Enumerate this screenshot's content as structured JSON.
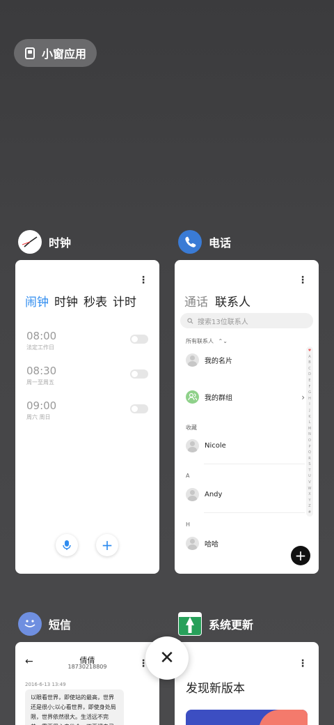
{
  "small_window": {
    "label": "小窗应用"
  },
  "apps": {
    "clock": {
      "name": "时钟",
      "tabs": [
        "闹钟",
        "时钟",
        "秒表",
        "计时"
      ],
      "alarms": [
        {
          "time": "08:00",
          "repeat": "法定工作日"
        },
        {
          "time": "08:30",
          "repeat": "周一至周五"
        },
        {
          "time": "09:00",
          "repeat": "周六 周日"
        }
      ]
    },
    "phone": {
      "name": "电话",
      "tabs": [
        "通话",
        "联系人"
      ],
      "search_placeholder": "搜索13位联系人",
      "filter_label": "所有联系人",
      "sections": {
        "favorites": "收藏",
        "a": "A",
        "h": "H"
      },
      "rows": {
        "my_card": "我的名片",
        "my_group": "我的群组",
        "nicole": "Nicole",
        "andy": "Andy",
        "haha": "哈哈"
      },
      "alpha_index": [
        "♥",
        "A",
        "B",
        "C",
        "D",
        "E",
        "F",
        "G",
        "H",
        "I",
        "J",
        "K",
        "L",
        "M",
        "N",
        "O",
        "P",
        "Q",
        "R",
        "S",
        "T",
        "U",
        "V",
        "W",
        "X",
        "Y",
        "Z",
        "#"
      ]
    },
    "sms": {
      "name": "短信",
      "contact": "倩倩",
      "number": "18730218809",
      "date": "2016-6-13 13:49",
      "message": "以眼看世界，即使站的最高，世界还是很小;以心看世界，即使身处局限，世界依然很大。生活远不完美，需要用心去体会，不要把自己"
    },
    "update": {
      "name": "系统更新",
      "title": "发现新版本"
    }
  },
  "colors": {
    "accent": "#2f8cef",
    "phone_icon": "#3a7bd5",
    "sms_icon": "#6f8fe0",
    "update_icon": "#27a05a"
  },
  "close_label": "✕"
}
